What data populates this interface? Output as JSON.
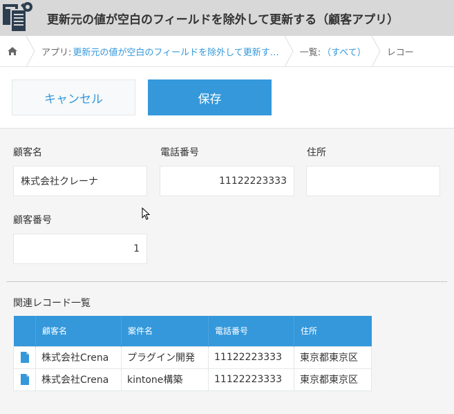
{
  "header": {
    "title": "更新元の値が空白のフィールドを除外して更新する（顧客アプリ）"
  },
  "breadcrumb": {
    "app_prefix": "アプリ:",
    "app_name": "更新元の値が空白のフィールドを除外して更新す…",
    "list_prefix": "一覧:",
    "list_name": "（すべて）",
    "record": "レコー"
  },
  "toolbar": {
    "cancel_label": "キャンセル",
    "save_label": "保存"
  },
  "form": {
    "customer_name_label": "顧客名",
    "customer_name_value": "株式会社クレーナ",
    "phone_label": "電話番号",
    "phone_value": "11122223333",
    "address_label": "住所",
    "address_value": "",
    "customer_no_label": "顧客番号",
    "customer_no_value": "1"
  },
  "related": {
    "title": "関連レコード一覧",
    "columns": [
      "顧客名",
      "案件名",
      "電話番号",
      "住所"
    ],
    "rows": [
      [
        "株式会社Crena",
        "プラグイン開発",
        "11122223333",
        "東京都東京区"
      ],
      [
        "株式会社Crena",
        "kintone構築",
        "11122223333",
        "東京都東京区"
      ]
    ]
  },
  "colors": {
    "accent": "#3498db",
    "header_bg": "#d8d8d8",
    "page_bg": "#f5f5f5"
  },
  "icons": {
    "app": "app-document-gear-icon",
    "home": "home-icon",
    "record": "document-icon",
    "cursor": "mouse-cursor-icon"
  }
}
